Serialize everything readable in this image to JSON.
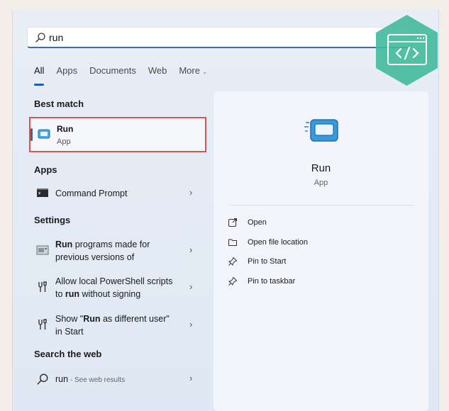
{
  "search": {
    "value": "run",
    "placeholder": ""
  },
  "tabs": [
    {
      "label": "All"
    },
    {
      "label": "Apps"
    },
    {
      "label": "Documents"
    },
    {
      "label": "Web"
    },
    {
      "label": "More"
    }
  ],
  "sections": {
    "best_match": "Best match",
    "apps": "Apps",
    "settings": "Settings",
    "search_web": "Search the web"
  },
  "best_match": {
    "title": "Run",
    "subtitle": "App"
  },
  "apps": [
    {
      "label": "Command Prompt",
      "icon": "command-prompt-icon"
    }
  ],
  "settings": [
    {
      "bold": "Run",
      "text_after": " programs made for",
      "line2": "previous versions of",
      "icon": "compatibility-icon"
    },
    {
      "line1": "Allow local PowerShell scripts",
      "line2_prefix": "to ",
      "bold": "run",
      "line2_suffix": " without signing",
      "icon": "developer-settings-icon"
    },
    {
      "line1_prefix": "Show \"",
      "bold": "Run",
      "line1_suffix": " as different user\"",
      "line2": "in Start",
      "icon": "developer-settings-icon"
    }
  ],
  "web": {
    "query": "run",
    "suffix": " - See web results",
    "icon": "search-icon"
  },
  "detail": {
    "title": "Run",
    "subtitle": "App"
  },
  "actions": [
    {
      "label": "Open",
      "icon": "open-icon"
    },
    {
      "label": "Open file location",
      "icon": "folder-icon"
    },
    {
      "label": "Pin to Start",
      "icon": "pin-icon"
    },
    {
      "label": "Pin to taskbar",
      "icon": "pin-icon"
    }
  ],
  "colors": {
    "accent": "#1a5fb4",
    "highlight_border": "#d9534f",
    "logo": "#3fb79a"
  }
}
